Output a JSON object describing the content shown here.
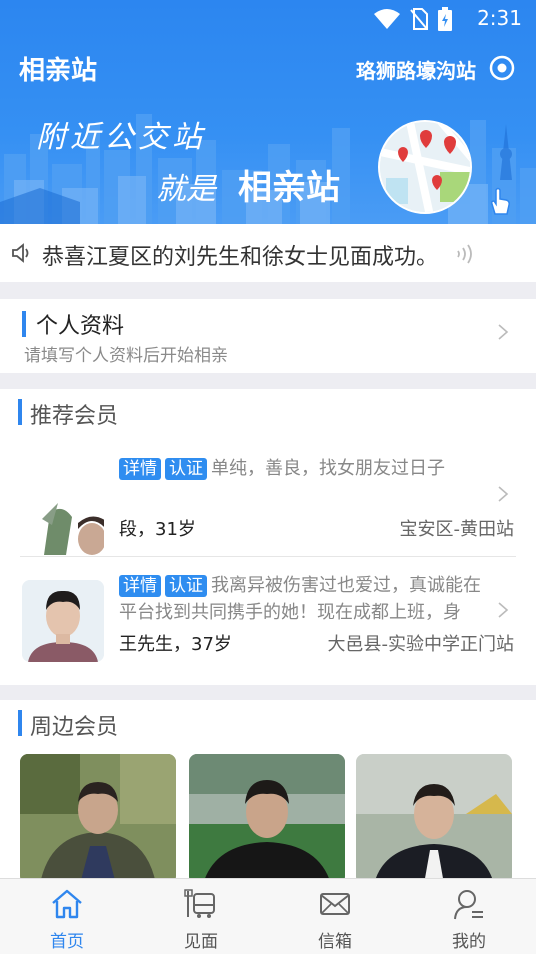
{
  "status_bar": {
    "time": "2:31"
  },
  "header": {
    "title": "相亲站",
    "station": "珞狮路壕沟站"
  },
  "banner": {
    "line1": "附近公交站",
    "line2_prefix": "就是",
    "line2_brand": "相亲站"
  },
  "notice": {
    "text": "恭喜江夏区的刘先生和徐女士见面成功。"
  },
  "profile": {
    "title": "个人资料",
    "subtitle": "请填写个人资料后开始相亲"
  },
  "recommend": {
    "title": "推荐会员",
    "members": [
      {
        "tag_detail": "详情",
        "tag_verified": "认证",
        "description": "单纯，善良，找女朋友过日子",
        "name_age": "段，31岁",
        "location": "宝安区-黄田站"
      },
      {
        "tag_detail": "详情",
        "tag_verified": "认证",
        "description": "我离异被伤害过也爱过，真诚能在平台找到共同携手的她！现在成都上班，身高...",
        "name_age": "王先生，37岁",
        "location": "大邑县-实验中学正门站"
      }
    ]
  },
  "nearby": {
    "title": "周边会员"
  },
  "tabs": [
    {
      "label": "首页",
      "icon": "home-icon",
      "active": true
    },
    {
      "label": "见面",
      "icon": "bus-icon",
      "active": false
    },
    {
      "label": "信箱",
      "icon": "mail-icon",
      "active": false
    },
    {
      "label": "我的",
      "icon": "user-icon",
      "active": false
    }
  ],
  "colors": {
    "accent": "#2f86ee",
    "header_bg": "#3590f3",
    "page_bg": "#ededf2"
  }
}
